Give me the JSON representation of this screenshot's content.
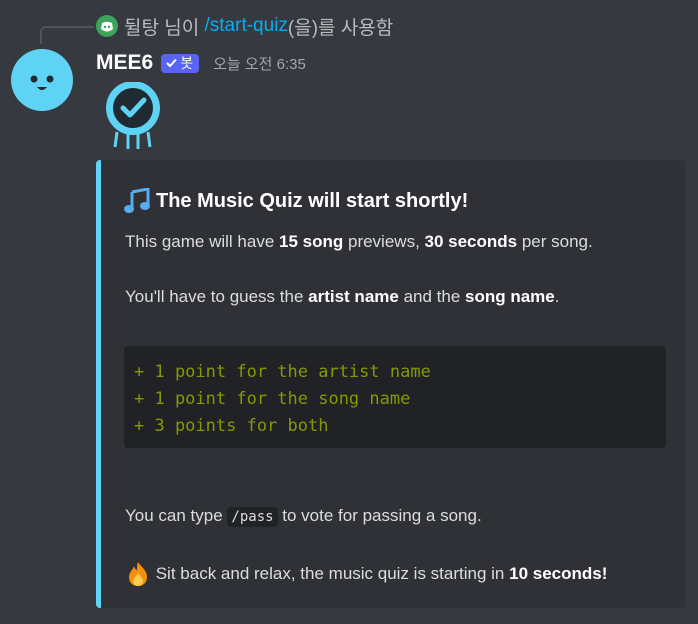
{
  "reply": {
    "user": "뒬탕",
    "middle": " 님이 ",
    "command": "/start-quiz",
    "suffix": "(을)를 사용함"
  },
  "message": {
    "username": "MEE6",
    "bot_badge": "봇",
    "timestamp": "오늘 오전 6:35"
  },
  "embed": {
    "accent_color": "#5fd3f3",
    "title_icon": "musical-note-icon",
    "title": "The Music Quiz will start shortly!",
    "line1": {
      "pre": "This game will have ",
      "b1": "15 song",
      "mid": " previews, ",
      "b2": "30 seconds",
      "post": " per song."
    },
    "line2": {
      "pre": "You'll have to guess the ",
      "b1": "artist name",
      "mid": " and the ",
      "b2": "song name",
      "post": "."
    },
    "code_lines": [
      "+ 1 point for the artist name",
      "+ 1 point for the song name",
      "+ 3 points for both"
    ],
    "line3": {
      "pre": "You can type ",
      "code": "/pass",
      "post": " to vote for passing a song."
    },
    "line4": {
      "icon": "fire-icon",
      "pre": " Sit back and relax, the music quiz is starting in ",
      "b1": "10 seconds!"
    }
  }
}
